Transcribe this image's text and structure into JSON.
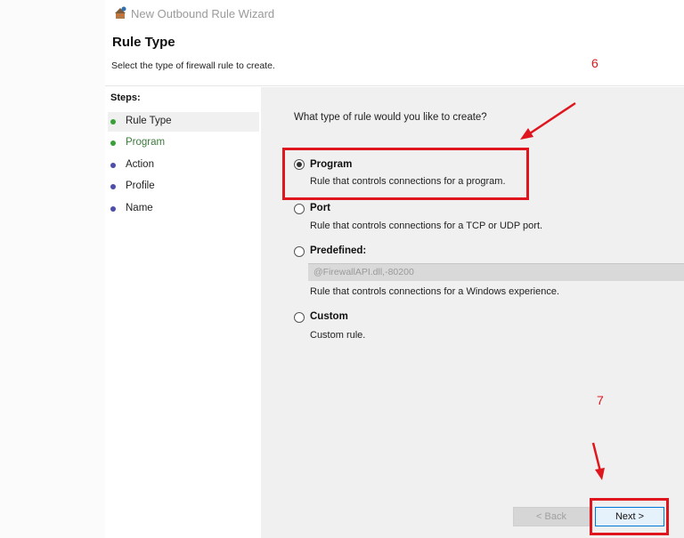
{
  "window": {
    "title": "New Outbound Rule Wizard"
  },
  "header": {
    "heading": "Rule Type",
    "subheading": "Select the type of firewall rule to create."
  },
  "steps": {
    "label": "Steps:",
    "items": [
      {
        "label": "Rule Type",
        "dot_color": "#3aa13a"
      },
      {
        "label": "Program",
        "dot_color": "#3aa13a"
      },
      {
        "label": "Action",
        "dot_color": "#4e4ea8"
      },
      {
        "label": "Profile",
        "dot_color": "#4e4ea8"
      },
      {
        "label": "Name",
        "dot_color": "#4e4ea8"
      }
    ]
  },
  "main": {
    "question": "What type of rule would you like to create?",
    "options": [
      {
        "label": "Program",
        "description": "Rule that controls connections for a program.",
        "selected": true
      },
      {
        "label": "Port",
        "description": "Rule that controls connections for a TCP or UDP port.",
        "selected": false
      },
      {
        "label": "Predefined:",
        "field_value": "@FirewallAPI.dll,-80200",
        "description": "Rule that controls connections for a Windows experience.",
        "selected": false
      },
      {
        "label": "Custom",
        "description": "Custom rule.",
        "selected": false
      }
    ]
  },
  "footer": {
    "back_label": "< Back",
    "next_label": "Next >"
  },
  "annotations": {
    "step6": "6",
    "step7": "7",
    "color": "#e0161e"
  }
}
